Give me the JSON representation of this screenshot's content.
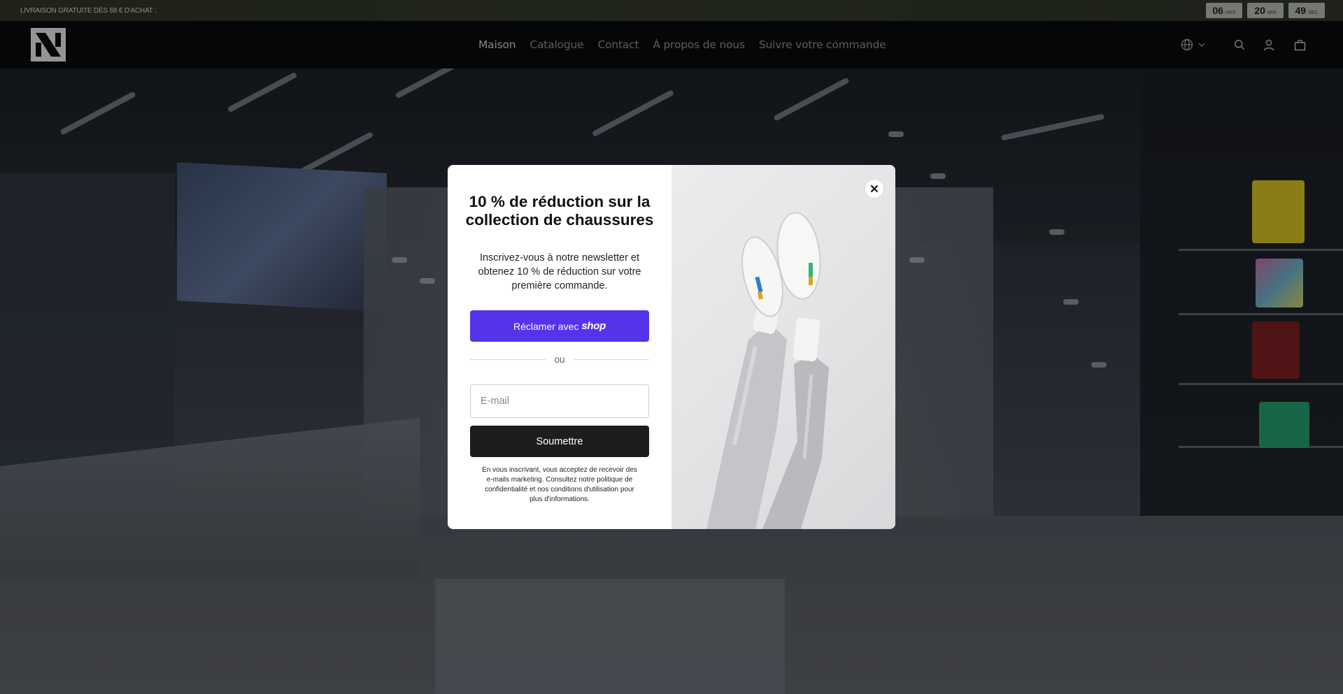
{
  "announcement": {
    "text": "LIVRAISON GRATUITE DÈS 68 € D'ACHAT :",
    "countdown": [
      {
        "value": "06",
        "unit": "HRS"
      },
      {
        "value": "20",
        "unit": "MIN"
      },
      {
        "value": "49",
        "unit": "SEC"
      }
    ]
  },
  "header": {
    "logo": "store-logo",
    "nav": [
      {
        "label": "Maison",
        "active": true
      },
      {
        "label": "Catalogue",
        "active": false
      },
      {
        "label": "Contact",
        "active": false
      },
      {
        "label": "À propos de nous",
        "active": false
      },
      {
        "label": "Suivre votre commande",
        "active": false
      }
    ],
    "icons": [
      "globe-icon",
      "chevron-down-icon",
      "search-icon",
      "account-icon",
      "cart-icon"
    ]
  },
  "modal": {
    "title": "10 % de réduction sur la collection de chaussures",
    "subtitle": "Inscrivez-vous à notre newsletter et obtenez 10 % de réduction sur votre première commande.",
    "shop_button": {
      "label": "Réclamer avec",
      "brand": "shop"
    },
    "divider": "ou",
    "email": {
      "placeholder": "E-mail",
      "value": ""
    },
    "submit_label": "Soumettre",
    "legal": "En vous inscrivant, vous acceptez de recevoir des e-mails marketing. Consultez notre politique de confidentialité et nos conditions d'utilisation pour plus d'informations.",
    "close_icon": "close-icon"
  },
  "colors": {
    "shop_purple": "#5433eb",
    "submit_dark": "#1d1d1d",
    "header_bg": "#020202",
    "announce_bg": "#2f3524"
  }
}
